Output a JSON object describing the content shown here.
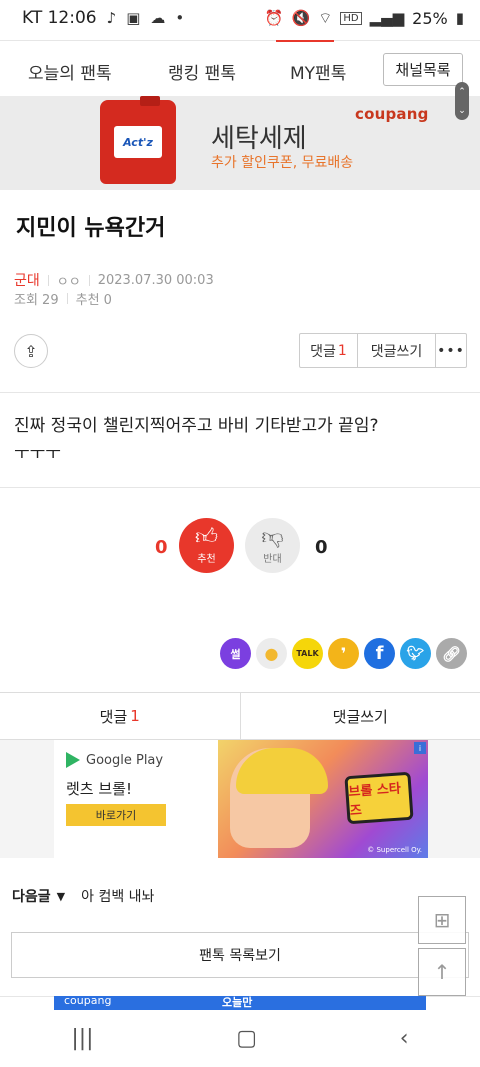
{
  "status_bar": {
    "carrier_time": "KT 12:06",
    "battery": "25%",
    "hd": "HD"
  },
  "top_nav": {
    "tabs": [
      "오늘의 팬톡",
      "랭킹 팬톡",
      "MY팬톡"
    ],
    "channel_list_button": "채널목록"
  },
  "ad_banner_1": {
    "title": "세탁세제",
    "subtitle": "추가 할인쿠폰, 무료배송",
    "brand": "coupang",
    "product_label": "Act'z"
  },
  "post": {
    "title": "지민이 뉴욕간거",
    "author": "군대",
    "badge": "ㅇㅇ",
    "datetime": "2023.07.30 00:03",
    "views": "조회 29",
    "recommends": "추천 0",
    "body_line1": "진짜 정국이 챌린지찍어주고 바비 기타받고가 끝임?",
    "body_line2": "ㅜㅜㅜ"
  },
  "actions": {
    "comment_label": "댓글",
    "comment_count": "1",
    "write_comment": "댓글쓰기",
    "more": "•••"
  },
  "vote": {
    "up_count": "0",
    "up_label": "추천",
    "down_label": "반대",
    "down_count": "0"
  },
  "social_icons": [
    "ssul-icon",
    "chat-bubble-icon",
    "kakaotalk-icon",
    "kakaostory-icon",
    "facebook-icon",
    "twitter-icon",
    "link-icon"
  ],
  "social_text": {
    "ssul": "썰",
    "talk": "TALK"
  },
  "comment_tabs": {
    "comments": "댓글",
    "comments_count": "1",
    "write": "댓글쓰기"
  },
  "ad_banner_2": {
    "store": "Google Play",
    "title": "렛츠 브롤!",
    "cta": "바로가기",
    "game_logo": "브롤 스타즈",
    "copyright": "© Supercell Oy."
  },
  "next_post": {
    "label": "다음글",
    "title": "아 컴백 내놔"
  },
  "list_button": "팬톡 목록보기",
  "ad_banner_3": {
    "brand": "coupang",
    "text": "오늘만"
  }
}
